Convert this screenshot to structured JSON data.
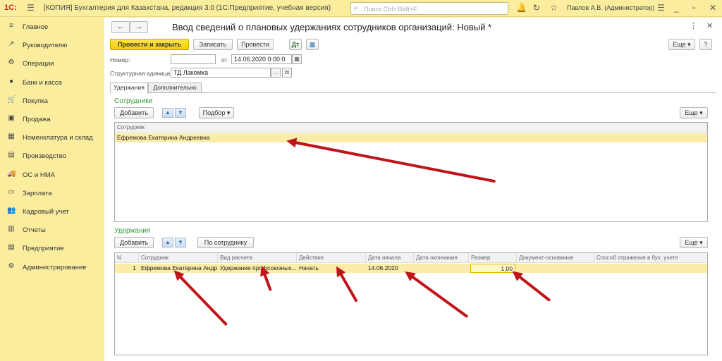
{
  "topbar": {
    "logo": "1С:",
    "title": "[КОПИЯ] Бухгалтерия для Казахстана, редакция 3.0  (1С:Предприятие, учебная версия)",
    "search_placeholder": "Поиск Ctrl+Shift+F",
    "user": "Павлов А.В. (Администратор)"
  },
  "sidebar": {
    "items": [
      {
        "label": "Главное",
        "icon": "≡"
      },
      {
        "label": "Руководителю",
        "icon": "↗"
      },
      {
        "label": "Операции",
        "icon": "⚙"
      },
      {
        "label": "Банк и касса",
        "icon": "●"
      },
      {
        "label": "Покупка",
        "icon": "🛒"
      },
      {
        "label": "Продажа",
        "icon": "▣"
      },
      {
        "label": "Номенклатура и склад",
        "icon": "▦"
      },
      {
        "label": "Производство",
        "icon": "▤"
      },
      {
        "label": "ОС и НМА",
        "icon": "🚚"
      },
      {
        "label": "Зарплата",
        "icon": "▭"
      },
      {
        "label": "Кадровый учет",
        "icon": "👥"
      },
      {
        "label": "Отчеты",
        "icon": "▥"
      },
      {
        "label": "Предприятие",
        "icon": "▤"
      },
      {
        "label": "Администрирование",
        "icon": "⚙"
      }
    ]
  },
  "document": {
    "title": "Ввод сведений о плановых удержаниях сотрудников организаций: Новый *",
    "toolbar": {
      "post_close": "Провести и закрыть",
      "save": "Записать",
      "post": "Провести",
      "more": "Еще"
    },
    "number_label": "Номер:",
    "number_value": "",
    "date_label": "от:",
    "date_value": "14.06.2020  0:00:0",
    "unit_label": "Структурная единица:",
    "unit_value": "ТД Лакомка"
  },
  "tabs": [
    {
      "label": "Удержания",
      "active": true
    },
    {
      "label": "Дополнительно",
      "active": false
    }
  ],
  "employees": {
    "section": "Сотрудники",
    "add": "Добавить",
    "pick": "Подбор",
    "more": "Еще",
    "header": "Сотрудник",
    "rows": [
      "Ефремова Екатерина Андреевна"
    ]
  },
  "deductions": {
    "section": "Удержания",
    "add": "Добавить",
    "by_employee": "По сотруднику",
    "more": "Еще",
    "headers": [
      "N",
      "Сотрудник",
      "Вид расчета",
      "Действие",
      "Дата начала",
      "Дата окончания",
      "Размер",
      "Документ-основание",
      "Способ отражения в бух. учете"
    ],
    "rows": [
      {
        "n": "1",
        "employee": "Ефремова Екатерина Андр...",
        "type": "Удержание профсоюзных...",
        "action": "Начать",
        "start": "14.06.2020",
        "end": "",
        "size": "1,00",
        "basis": "",
        "method": ""
      }
    ]
  },
  "colors": {
    "accent": "#fbed9e",
    "primary_button": "#f2cd12",
    "section_green": "#3a9a3a",
    "selection": "#fbeca8",
    "annotation_arrow": "#c0141a"
  }
}
